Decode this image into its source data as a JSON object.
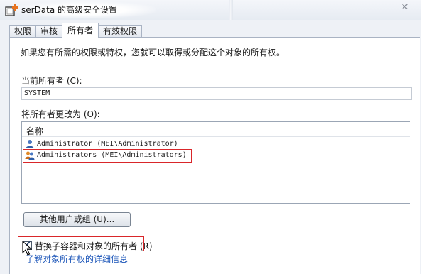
{
  "window": {
    "title": "serData 的高级安全设置",
    "close_icon": "close-icon"
  },
  "tabs": [
    {
      "label": "权限",
      "active": false
    },
    {
      "label": "审核",
      "active": false
    },
    {
      "label": "所有者",
      "active": true
    },
    {
      "label": "有效权限",
      "active": false
    }
  ],
  "owner_tab": {
    "description": "如果您有所需的权限或特权，您就可以取得或分配这个对象的所有权。",
    "current_owner_label": "当前所有者 (C):",
    "current_owner_value": "SYSTEM",
    "change_owner_label": "将所有者更改为 (O):",
    "list_column_header": "名称",
    "owners": [
      {
        "label": "Administrator (MEI\\Administrator)",
        "icon": "user-icon",
        "highlighted": false
      },
      {
        "label": "Administrators (MEI\\Administrators)",
        "icon": "user-group-icon",
        "highlighted": true
      }
    ],
    "other_users_button": "其他用户或组 (U)...",
    "replace_checkbox_label": "替换子容器和对象的所有者 (R)",
    "replace_checkbox_checked": true,
    "help_link": "了解对象所有权的详细信息"
  },
  "colors": {
    "highlight": "#d9262a",
    "link": "#1a54b8"
  }
}
